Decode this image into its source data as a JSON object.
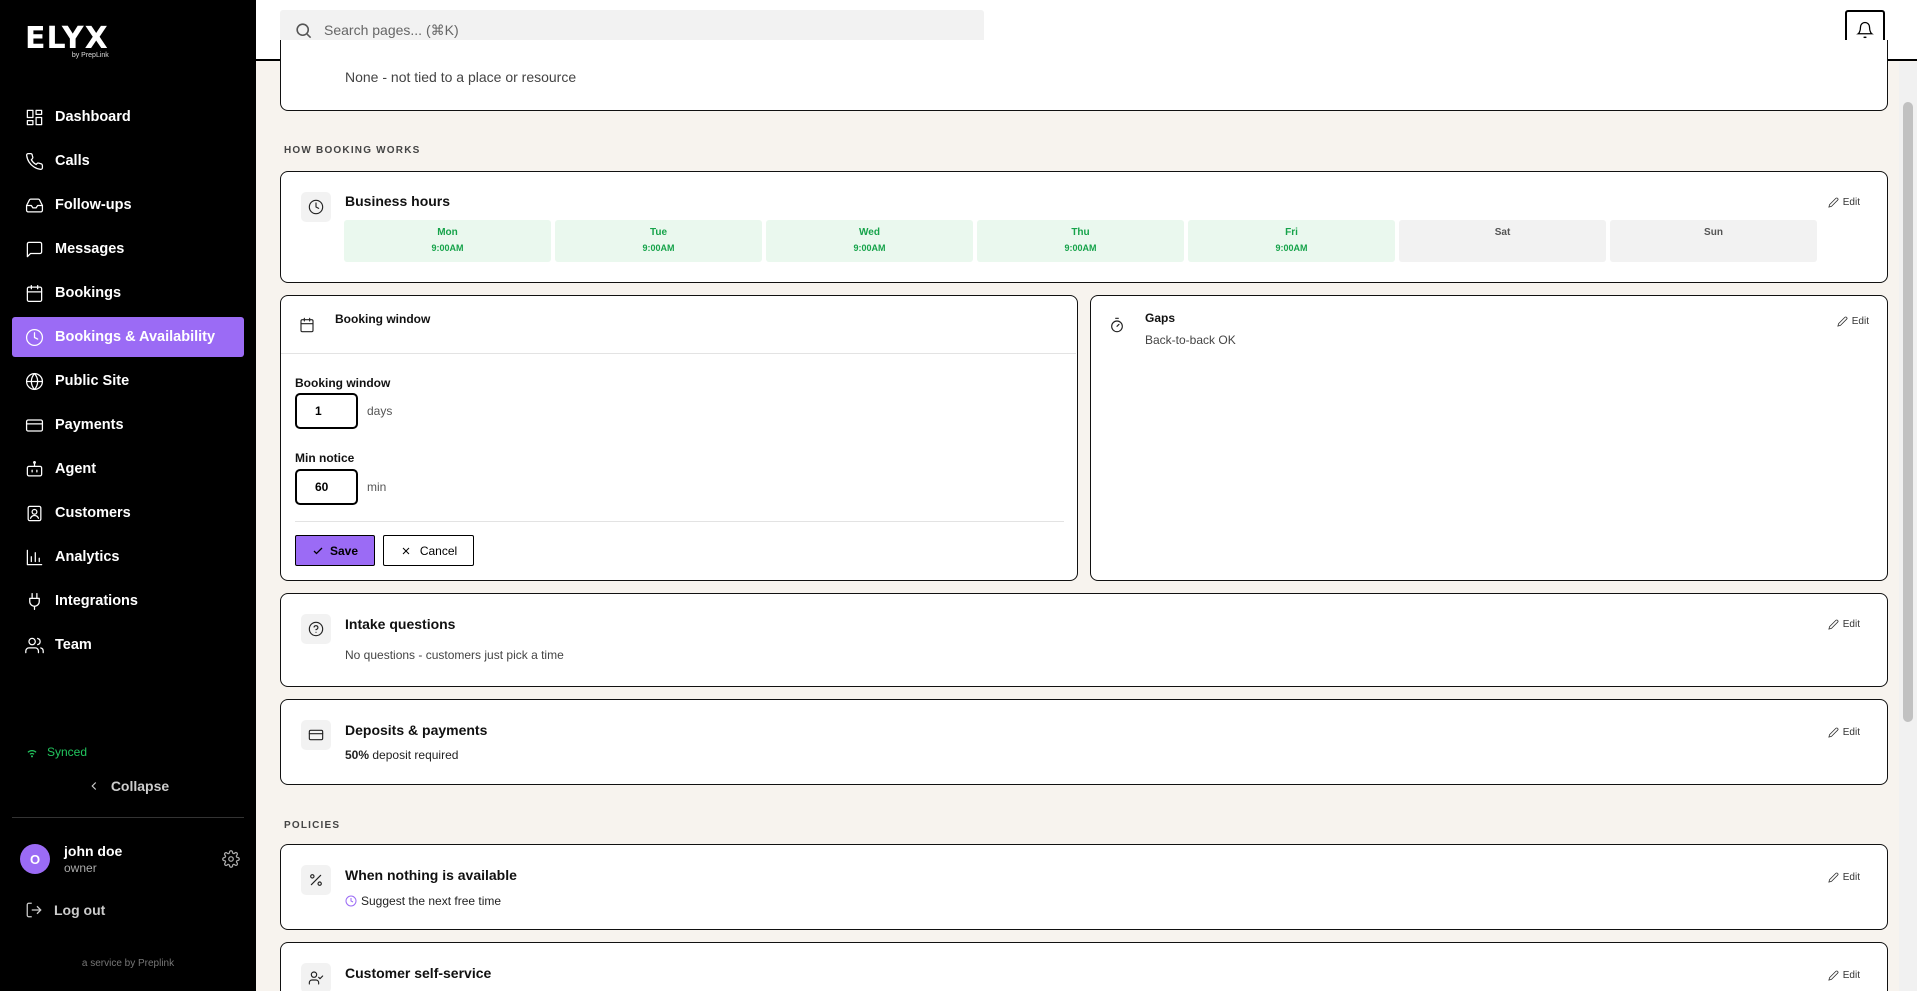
{
  "brand": {
    "logo": "ELYX",
    "logo_sub": "by PrepLink"
  },
  "sidebar": {
    "items": [
      {
        "label": "Dashboard",
        "icon": "dashboard-icon"
      },
      {
        "label": "Calls",
        "icon": "phone-icon"
      },
      {
        "label": "Follow-ups",
        "icon": "inbox-icon"
      },
      {
        "label": "Messages",
        "icon": "message-icon"
      },
      {
        "label": "Bookings",
        "icon": "calendar-icon"
      },
      {
        "label": "Bookings & Availability",
        "icon": "clock-icon",
        "active": true
      },
      {
        "label": "Public Site",
        "icon": "globe-icon"
      },
      {
        "label": "Payments",
        "icon": "card-icon"
      },
      {
        "label": "Agent",
        "icon": "bot-icon"
      },
      {
        "label": "Customers",
        "icon": "contact-icon"
      },
      {
        "label": "Analytics",
        "icon": "chart-icon"
      },
      {
        "label": "Integrations",
        "icon": "plug-icon"
      },
      {
        "label": "Team",
        "icon": "users-icon"
      }
    ],
    "status": "Synced",
    "collapse_label": "Collapse",
    "user": {
      "initial": "O",
      "name": "john doe",
      "role": "owner"
    },
    "logout_label": "Log out",
    "service_text": "a service by Preplink"
  },
  "search": {
    "placeholder": "Search pages... (⌘K)"
  },
  "location_card": {
    "subtitle": "None - not tied to a place or resource"
  },
  "sections": {
    "how_booking_works": "HOW BOOKING WORKS",
    "policies": "POLICIES"
  },
  "business_hours": {
    "title": "Business hours",
    "edit": "Edit",
    "days": [
      {
        "name": "Mon",
        "time": "9:00AM",
        "open": true
      },
      {
        "name": "Tue",
        "time": "9:00AM",
        "open": true
      },
      {
        "name": "Wed",
        "time": "9:00AM",
        "open": true
      },
      {
        "name": "Thu",
        "time": "9:00AM",
        "open": true
      },
      {
        "name": "Fri",
        "time": "9:00AM",
        "open": true
      },
      {
        "name": "Sat",
        "time": "",
        "open": false
      },
      {
        "name": "Sun",
        "time": "",
        "open": false
      }
    ]
  },
  "booking_window": {
    "title": "Booking window",
    "window_label": "Booking window",
    "window_value": "1",
    "window_unit": "days",
    "notice_label": "Min notice",
    "notice_value": "60",
    "notice_unit": "min",
    "save_label": "Save",
    "cancel_label": "Cancel"
  },
  "gaps": {
    "title": "Gaps",
    "subtitle": "Back-to-back OK",
    "edit": "Edit"
  },
  "intake": {
    "title": "Intake questions",
    "subtitle": "No questions - customers just pick a time",
    "edit": "Edit"
  },
  "deposits": {
    "title": "Deposits & payments",
    "amount": "50%",
    "subtitle": "deposit required",
    "edit": "Edit"
  },
  "nothing_available": {
    "title": "When nothing is available",
    "subtitle": "Suggest the next free time",
    "edit": "Edit"
  },
  "self_service": {
    "title": "Customer self-service",
    "edit": "Edit"
  },
  "colors": {
    "accent": "#9b6bf5",
    "success": "#16a34a",
    "open_day_bg": "#eaf8ee"
  }
}
